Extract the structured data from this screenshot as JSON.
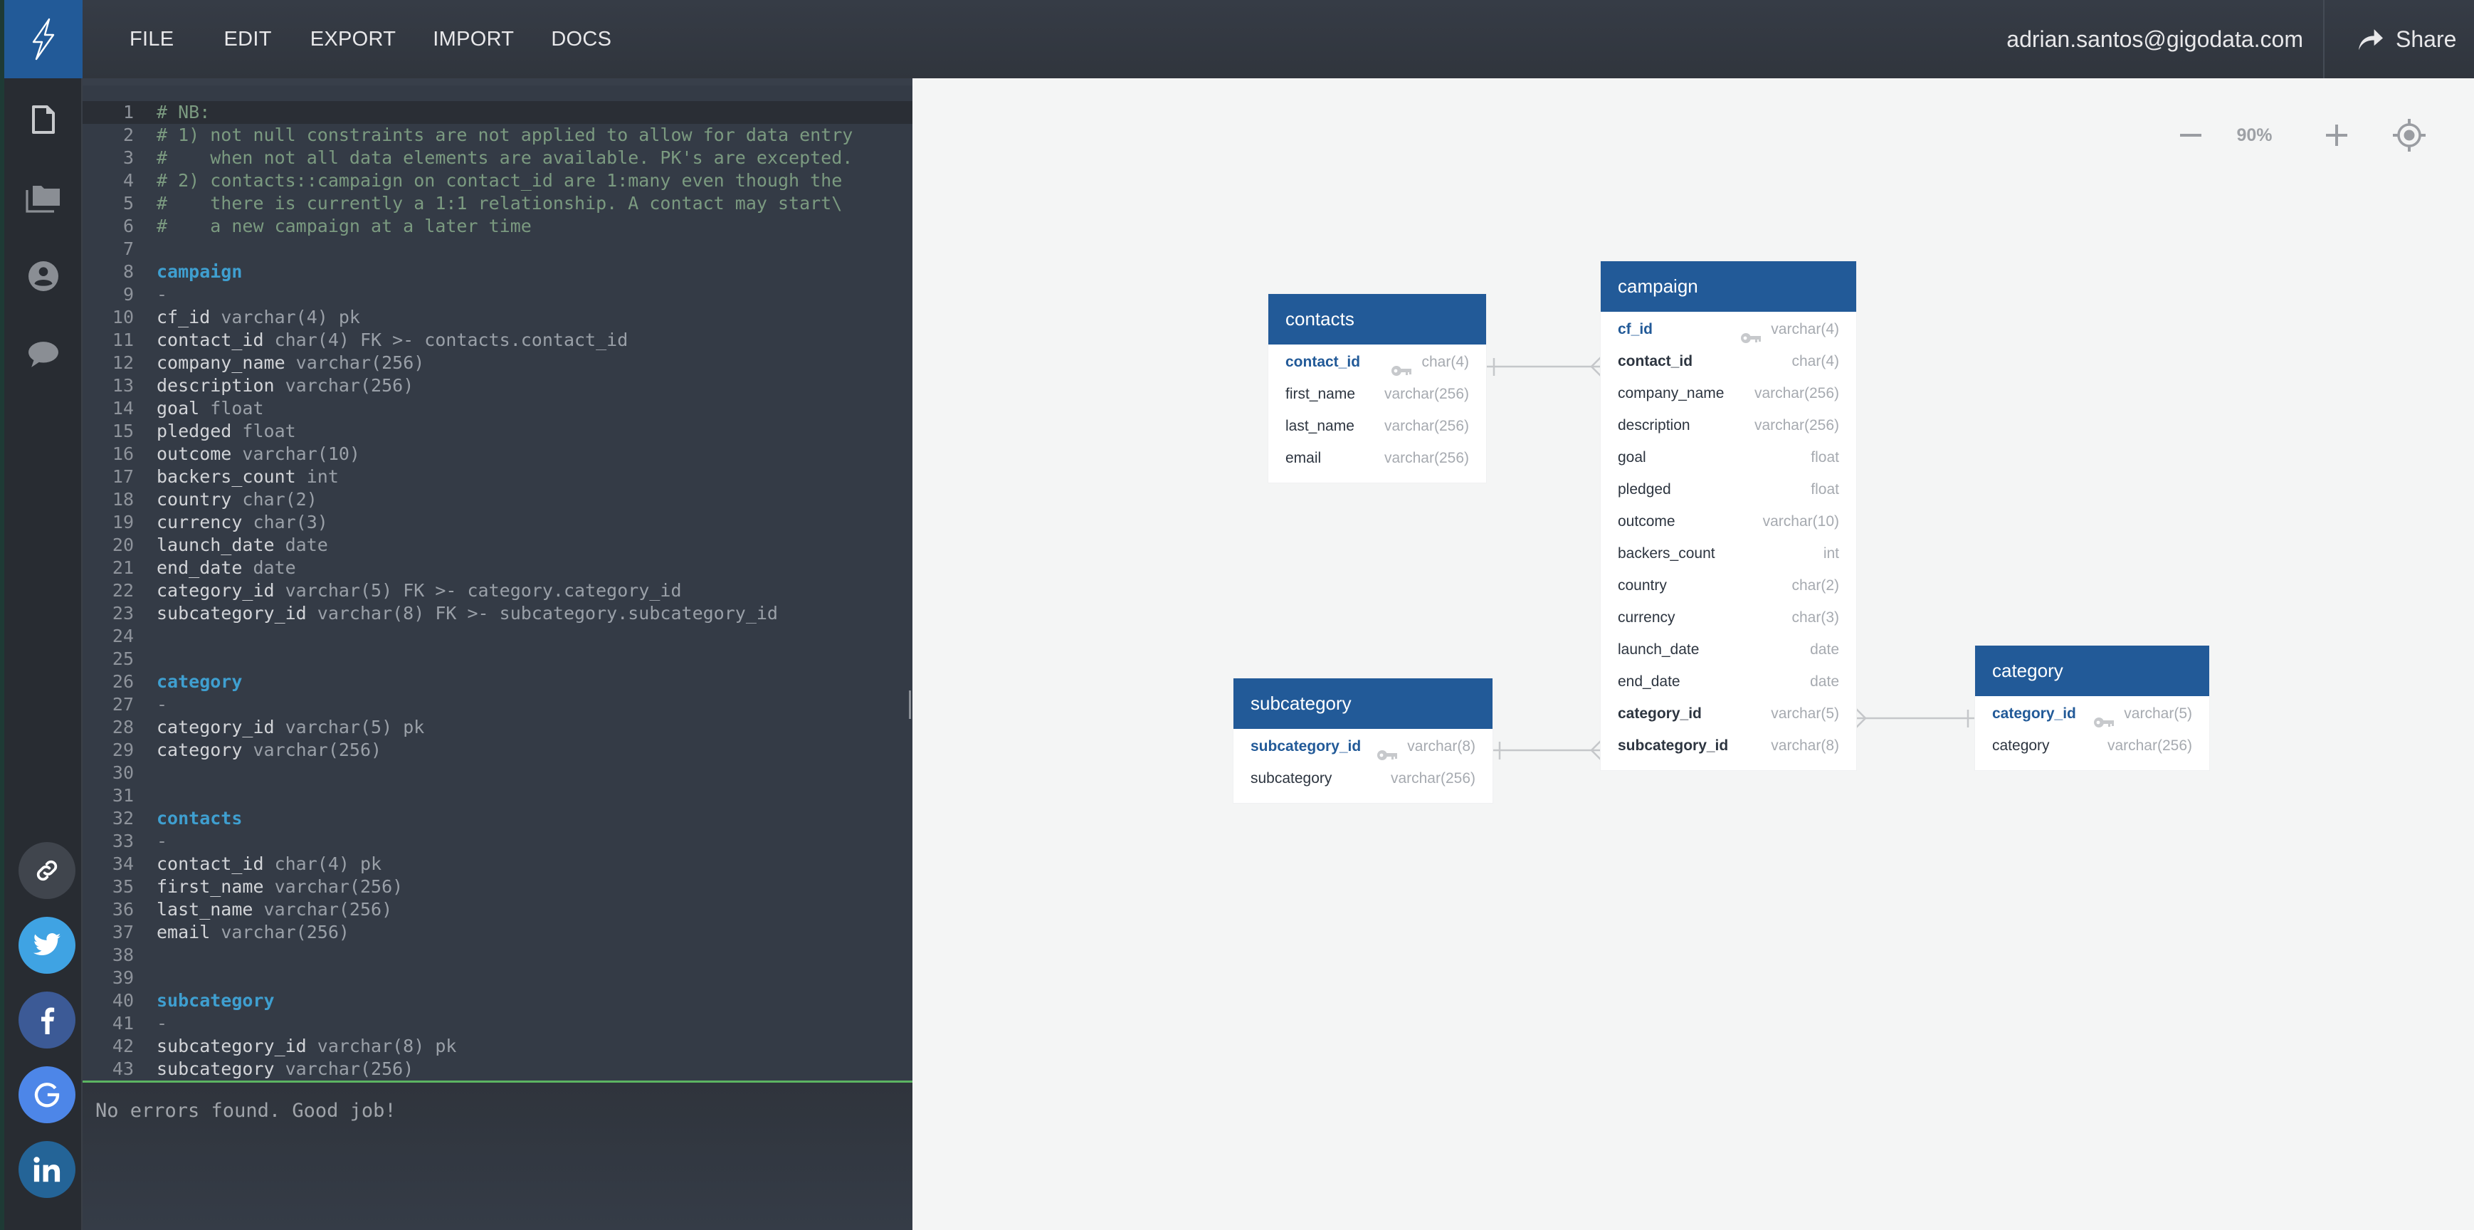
{
  "header": {
    "menu": [
      "FILE",
      "EDIT",
      "EXPORT",
      "IMPORT",
      "DOCS"
    ],
    "user_email": "adrian.santos@gigodata.com",
    "share_label": "Share"
  },
  "sidebar": {
    "nav_icons": [
      "document-icon",
      "folders-icon",
      "account-icon",
      "chat-icon"
    ],
    "social": [
      "link-icon",
      "twitter-icon",
      "facebook-icon",
      "google-icon",
      "linkedin-icon"
    ]
  },
  "editor": {
    "active_line": 1,
    "lines": [
      {
        "n": "1",
        "parts": [
          {
            "c": "comment",
            "t": "# NB:"
          }
        ]
      },
      {
        "n": "2",
        "parts": [
          {
            "c": "comment",
            "t": "# 1) not null constraints are not applied to allow for data entry"
          }
        ]
      },
      {
        "n": "3",
        "parts": [
          {
            "c": "comment",
            "t": "#    when not all data elements are available. PK's are excepted."
          }
        ]
      },
      {
        "n": "4",
        "parts": [
          {
            "c": "comment",
            "t": "# 2) contacts::campaign on contact_id are 1:many even though the"
          }
        ]
      },
      {
        "n": "5",
        "parts": [
          {
            "c": "comment",
            "t": "#    there is currently a 1:1 relationship. A contact may start\\"
          }
        ]
      },
      {
        "n": "6",
        "parts": [
          {
            "c": "comment",
            "t": "#    a new campaign at a later time"
          }
        ]
      },
      {
        "n": "7",
        "parts": []
      },
      {
        "n": "8",
        "parts": [
          {
            "c": "table",
            "t": "campaign"
          }
        ]
      },
      {
        "n": "9",
        "parts": [
          {
            "c": "dash",
            "t": "-"
          }
        ]
      },
      {
        "n": "10",
        "parts": [
          {
            "c": "name",
            "t": "cf_id"
          },
          {
            "c": "type",
            "t": " varchar(4) pk"
          }
        ]
      },
      {
        "n": "11",
        "parts": [
          {
            "c": "name",
            "t": "contact_id"
          },
          {
            "c": "type",
            "t": " char(4) FK >- contacts.contact_id"
          }
        ]
      },
      {
        "n": "12",
        "parts": [
          {
            "c": "name",
            "t": "company_name"
          },
          {
            "c": "type",
            "t": " varchar(256)"
          }
        ]
      },
      {
        "n": "13",
        "parts": [
          {
            "c": "name",
            "t": "description"
          },
          {
            "c": "type",
            "t": " varchar(256)"
          }
        ]
      },
      {
        "n": "14",
        "parts": [
          {
            "c": "name",
            "t": "goal"
          },
          {
            "c": "type",
            "t": " float"
          }
        ]
      },
      {
        "n": "15",
        "parts": [
          {
            "c": "name",
            "t": "pledged"
          },
          {
            "c": "type",
            "t": " float"
          }
        ]
      },
      {
        "n": "16",
        "parts": [
          {
            "c": "name",
            "t": "outcome"
          },
          {
            "c": "type",
            "t": " varchar(10)"
          }
        ]
      },
      {
        "n": "17",
        "parts": [
          {
            "c": "name",
            "t": "backers_count"
          },
          {
            "c": "type",
            "t": " int"
          }
        ]
      },
      {
        "n": "18",
        "parts": [
          {
            "c": "name",
            "t": "country"
          },
          {
            "c": "type",
            "t": " char(2)"
          }
        ]
      },
      {
        "n": "19",
        "parts": [
          {
            "c": "name",
            "t": "currency"
          },
          {
            "c": "type",
            "t": " char(3)"
          }
        ]
      },
      {
        "n": "20",
        "parts": [
          {
            "c": "name",
            "t": "launch_date"
          },
          {
            "c": "type",
            "t": " date"
          }
        ]
      },
      {
        "n": "21",
        "parts": [
          {
            "c": "name",
            "t": "end_date"
          },
          {
            "c": "type",
            "t": " date"
          }
        ]
      },
      {
        "n": "22",
        "parts": [
          {
            "c": "name",
            "t": "category_id"
          },
          {
            "c": "type",
            "t": " varchar(5) FK >- category.category_id"
          }
        ]
      },
      {
        "n": "23",
        "parts": [
          {
            "c": "name",
            "t": "subcategory_id"
          },
          {
            "c": "type",
            "t": " varchar(8) FK >- subcategory.subcategory_id"
          }
        ]
      },
      {
        "n": "24",
        "parts": []
      },
      {
        "n": "25",
        "parts": []
      },
      {
        "n": "26",
        "parts": [
          {
            "c": "table",
            "t": "category"
          }
        ]
      },
      {
        "n": "27",
        "parts": [
          {
            "c": "dash",
            "t": "-"
          }
        ]
      },
      {
        "n": "28",
        "parts": [
          {
            "c": "name",
            "t": "category_id"
          },
          {
            "c": "type",
            "t": " varchar(5) pk"
          }
        ]
      },
      {
        "n": "29",
        "parts": [
          {
            "c": "name",
            "t": "category"
          },
          {
            "c": "type",
            "t": " varchar(256)"
          }
        ]
      },
      {
        "n": "30",
        "parts": []
      },
      {
        "n": "31",
        "parts": []
      },
      {
        "n": "32",
        "parts": [
          {
            "c": "table",
            "t": "contacts"
          }
        ]
      },
      {
        "n": "33",
        "parts": [
          {
            "c": "dash",
            "t": "-"
          }
        ]
      },
      {
        "n": "34",
        "parts": [
          {
            "c": "name",
            "t": "contact_id"
          },
          {
            "c": "type",
            "t": " char(4) pk"
          }
        ]
      },
      {
        "n": "35",
        "parts": [
          {
            "c": "name",
            "t": "first_name"
          },
          {
            "c": "type",
            "t": " varchar(256)"
          }
        ]
      },
      {
        "n": "36",
        "parts": [
          {
            "c": "name",
            "t": "last_name"
          },
          {
            "c": "type",
            "t": " varchar(256)"
          }
        ]
      },
      {
        "n": "37",
        "parts": [
          {
            "c": "name",
            "t": "email"
          },
          {
            "c": "type",
            "t": " varchar(256)"
          }
        ]
      },
      {
        "n": "38",
        "parts": []
      },
      {
        "n": "39",
        "parts": []
      },
      {
        "n": "40",
        "parts": [
          {
            "c": "table",
            "t": "subcategory"
          }
        ]
      },
      {
        "n": "41",
        "parts": [
          {
            "c": "dash",
            "t": "-"
          }
        ]
      },
      {
        "n": "42",
        "parts": [
          {
            "c": "name",
            "t": "subcategory_id"
          },
          {
            "c": "type",
            "t": " varchar(8) pk"
          }
        ]
      },
      {
        "n": "43",
        "parts": [
          {
            "c": "name",
            "t": "subcategory"
          },
          {
            "c": "type",
            "t": " varchar(256)"
          }
        ]
      }
    ],
    "status_message": "No errors found. Good job!"
  },
  "diagram": {
    "zoom_level": "90%",
    "zoom_out_icon": "minus-icon",
    "zoom_in_icon": "plus-icon",
    "center_icon": "locate-icon",
    "tables": {
      "contacts": {
        "title": "contacts",
        "fields": [
          {
            "name": "contact_id",
            "type": "char(4)",
            "role": "pk"
          },
          {
            "name": "first_name",
            "type": "varchar(256)",
            "role": ""
          },
          {
            "name": "last_name",
            "type": "varchar(256)",
            "role": ""
          },
          {
            "name": "email",
            "type": "varchar(256)",
            "role": ""
          }
        ]
      },
      "campaign": {
        "title": "campaign",
        "fields": [
          {
            "name": "cf_id",
            "type": "varchar(4)",
            "role": "pk"
          },
          {
            "name": "contact_id",
            "type": "char(4)",
            "role": "fk"
          },
          {
            "name": "company_name",
            "type": "varchar(256)",
            "role": ""
          },
          {
            "name": "description",
            "type": "varchar(256)",
            "role": ""
          },
          {
            "name": "goal",
            "type": "float",
            "role": ""
          },
          {
            "name": "pledged",
            "type": "float",
            "role": ""
          },
          {
            "name": "outcome",
            "type": "varchar(10)",
            "role": ""
          },
          {
            "name": "backers_count",
            "type": "int",
            "role": ""
          },
          {
            "name": "country",
            "type": "char(2)",
            "role": ""
          },
          {
            "name": "currency",
            "type": "char(3)",
            "role": ""
          },
          {
            "name": "launch_date",
            "type": "date",
            "role": ""
          },
          {
            "name": "end_date",
            "type": "date",
            "role": ""
          },
          {
            "name": "category_id",
            "type": "varchar(5)",
            "role": "fk"
          },
          {
            "name": "subcategory_id",
            "type": "varchar(8)",
            "role": "fk"
          }
        ]
      },
      "subcategory": {
        "title": "subcategory",
        "fields": [
          {
            "name": "subcategory_id",
            "type": "varchar(8)",
            "role": "pk"
          },
          {
            "name": "subcategory",
            "type": "varchar(256)",
            "role": ""
          }
        ]
      },
      "category": {
        "title": "category",
        "fields": [
          {
            "name": "category_id",
            "type": "varchar(5)",
            "role": "pk"
          },
          {
            "name": "category",
            "type": "varchar(256)",
            "role": ""
          }
        ]
      }
    },
    "relationships": [
      {
        "from": "campaign.contact_id",
        "to": "contacts.contact_id",
        "type": "many-to-one"
      },
      {
        "from": "campaign.subcategory_id",
        "to": "subcategory.subcategory_id",
        "type": "many-to-one"
      },
      {
        "from": "campaign.category_id",
        "to": "category.category_id",
        "type": "many-to-one"
      }
    ]
  }
}
